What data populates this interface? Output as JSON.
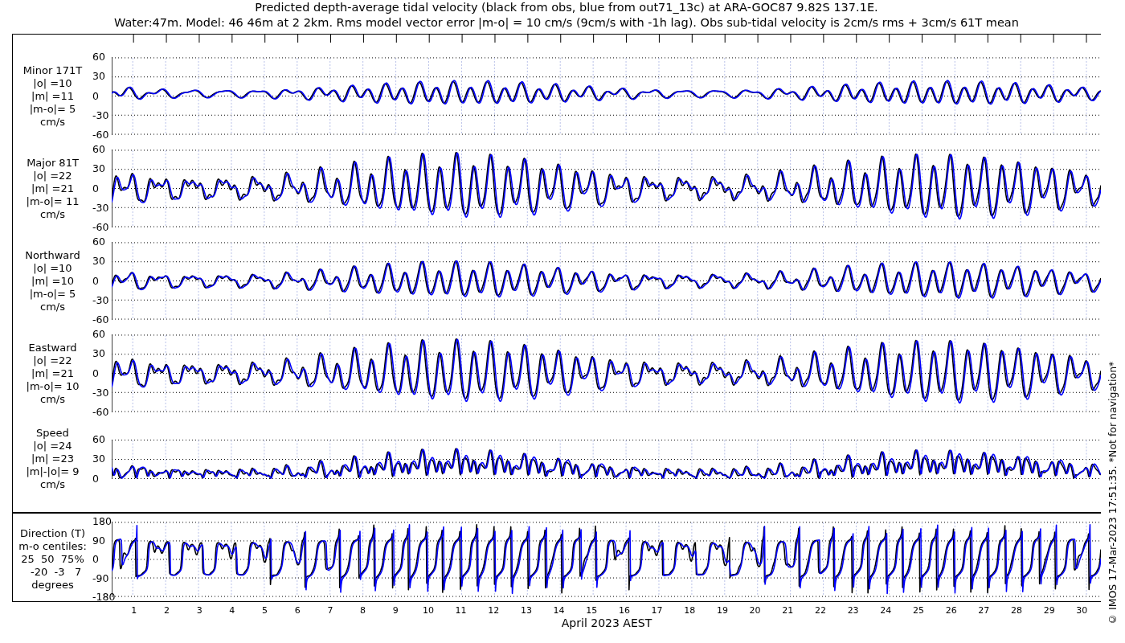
{
  "title_lines": [
    "Predicted depth-average tidal velocity (black from obs, blue from out71_13c) at ARA-GOC87 9.82S 137.1E.",
    "Water:47m. Model: 46 46m at 2 2km. Rms model vector error |m-o| = 10 cm/s (9cm/s with -1h lag). Obs sub-tidal velocity is 2cm/s rms + 3cm/s 61T mean"
  ],
  "series": [
    {
      "color": "#000000"
    },
    {
      "color": "#0000ff"
    }
  ],
  "panels": [
    {
      "kind": "minor",
      "label_lines": [
        "Minor 171T",
        "|o| =10",
        "|m| =11",
        "|m-o|= 5",
        "cm/s"
      ],
      "yticks": [
        "60",
        "30",
        "0",
        "-30",
        "-60"
      ]
    },
    {
      "kind": "major",
      "label_lines": [
        "Major 81T",
        "|o| =22",
        "|m| =21",
        "|m-o|= 11",
        "cm/s"
      ],
      "yticks": [
        "60",
        "30",
        "0",
        "-30",
        "-60"
      ]
    },
    {
      "kind": "northward",
      "label_lines": [
        "Northward",
        "|o| =10",
        "|m| =10",
        "|m-o|= 5",
        "cm/s"
      ],
      "yticks": [
        "60",
        "30",
        "0",
        "-30",
        "-60"
      ]
    },
    {
      "kind": "eastward",
      "label_lines": [
        "Eastward",
        "|o| =22",
        "|m| =21",
        "|m-o|= 10",
        "cm/s"
      ],
      "yticks": [
        "60",
        "30",
        "0",
        "-30",
        "-60"
      ]
    },
    {
      "kind": "speed",
      "label_lines": [
        "Speed",
        "|o| =24",
        "|m| =23",
        "|m|-|o|= 9",
        "cm/s"
      ],
      "yticks": [
        "60",
        "30",
        "0"
      ]
    }
  ],
  "direction_panel": {
    "kind": "direction",
    "label_lines": [
      "Direction (T)",
      "m-o centiles:",
      "25  50  75%",
      "  -20  -3   7",
      "degrees"
    ],
    "yticks": [
      "180",
      "90",
      "0",
      "-90",
      "-180"
    ]
  },
  "xticks": [
    "1",
    "2",
    "3",
    "4",
    "5",
    "6",
    "7",
    "8",
    "9",
    "10",
    "11",
    "12",
    "13",
    "14",
    "15",
    "16",
    "17",
    "18",
    "19",
    "20",
    "21",
    "22",
    "23",
    "24",
    "25",
    "26",
    "27",
    "28",
    "29",
    "30"
  ],
  "xlabel": "April 2023 AEST",
  "credit": "© IMOS 17-Mar-2023 17:51:35. *Not for navigation*"
}
